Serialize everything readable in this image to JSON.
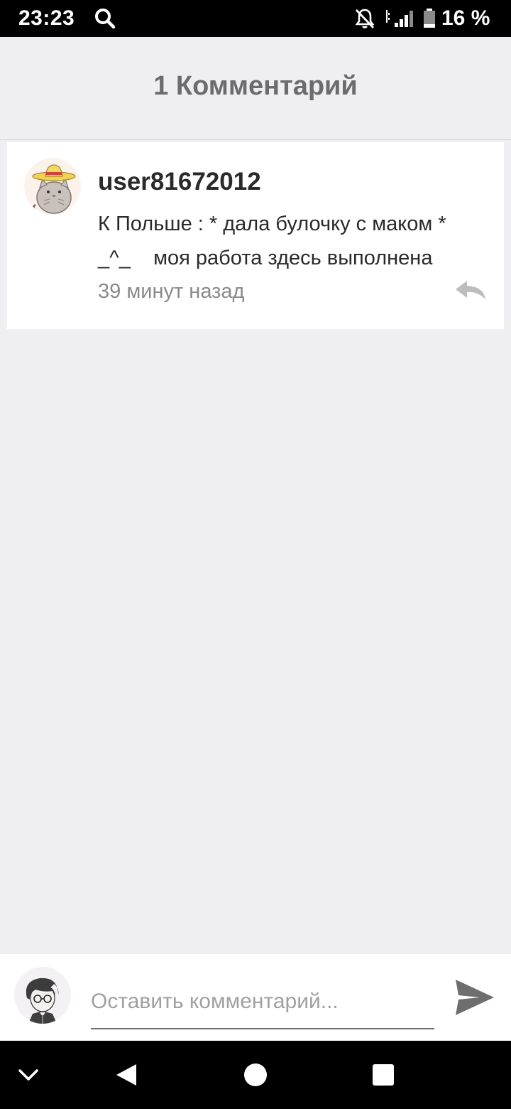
{
  "status_bar": {
    "time": "23:23",
    "battery_percent": "16 %",
    "icons": [
      "search-icon",
      "notifications-muted-icon",
      "signal-icon",
      "battery-icon"
    ]
  },
  "header": {
    "title": "1 Комментарий"
  },
  "comments": [
    {
      "username": "user81672012",
      "text": "К Польше : * дала булочку с маком *\n_^_    моя работа здесь выполнена",
      "time": "39 минут назад",
      "avatar_icon": "cat-sombrero-avatar",
      "reply_icon": "reply-icon"
    }
  ],
  "input_bar": {
    "placeholder": "Оставить комментарий...",
    "value": "",
    "send_icon": "send-icon",
    "avatar_icon": "user-avatar"
  },
  "nav_bar": {
    "icons": [
      "chevron-down-icon",
      "back-icon",
      "home-icon",
      "recents-icon"
    ]
  },
  "colors": {
    "background": "#efeef1",
    "card": "#ffffff",
    "title": "#6c6c6c",
    "text": "#2a2a2a",
    "muted": "#8a8a8a"
  }
}
